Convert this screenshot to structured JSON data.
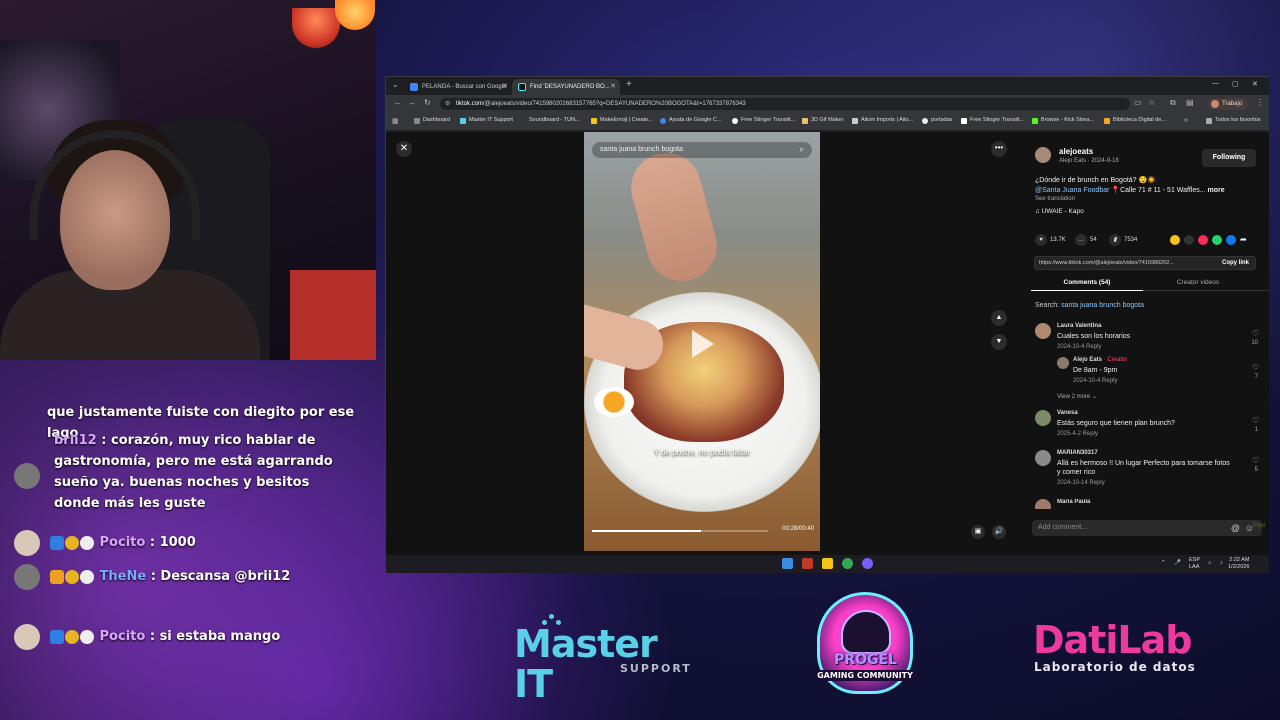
{
  "chat": {
    "messages": [
      {
        "user": "",
        "text": "que justamente fuiste con diegito por ese lago"
      },
      {
        "user": "brii12",
        "text": ": corazón, muy rico hablar de gastronomía, pero me está agarrando sueño ya. buenas noches y besitos donde más les guste"
      },
      {
        "user": "Pocito",
        "text": ": 1000"
      },
      {
        "user": "TheNe",
        "text": ": Descansa @brii12"
      },
      {
        "user": "Pocito",
        "text": ": si estaba mango"
      }
    ]
  },
  "browser": {
    "tabs": [
      {
        "label": "PELANGA - Buscar con Google",
        "active": false
      },
      {
        "label": "Find 'DESAYUNADERO BO...",
        "active": true
      }
    ],
    "url_host": "tiktok.com",
    "url_path": "/@alejoeats/video/7415980202683157765?q=DESAYUNADERO%20BOGOTA&t=1767337876343",
    "profile_label": "Trabajo",
    "bookmarks": [
      "Dashboard",
      "Master IT Support",
      "Soundboard - TUN...",
      "MakeEmoji | Create...",
      "Ayuda de Google C...",
      "Free Stinger Transiti...",
      "3D Gif Maker",
      "Aitum Imports | Aitu...",
      "portadas",
      "Free Stinger Transiti...",
      "Browse - Kick Strea...",
      "Biblioteca Digital de...",
      "Todos los favoritos"
    ]
  },
  "video": {
    "search_text": "santa juana brunch bogota",
    "caption": "Y de postre, no podía faltar",
    "time": "00:28/00:40",
    "progress_fraction": 0.62
  },
  "post": {
    "author": "alejoeats",
    "author_sub": "Alejo Eats · 2024-9-18",
    "follow_label": "Following",
    "desc_line1": "¿Dónde ir de brunch en Bogotá? 🤤☀️",
    "desc_tag": "@Santa Juana Foodbar",
    "desc_rest": " 📍Calle 71 # 11 - 51 Waffles...",
    "more_label": "more",
    "see_translation": "See translation",
    "music": "♫ UWAIE - Kapo",
    "likes": "13.7K",
    "comments_count": "54",
    "saves": "7534",
    "link": "https://www.tiktok.com/@alejoeats/video/7415980202...",
    "copy_link": "Copy link",
    "tab_comments": "Comments (54)",
    "tab_creator": "Creator videos",
    "search_prefix": "Search:",
    "search_query": "santa juana brunch bogota",
    "comments": [
      {
        "name": "Laura Valentina",
        "text": "Cuales son los horarios",
        "meta": "2024-10-4     Reply",
        "likes": "10"
      },
      {
        "name": "Alejo Eats",
        "creator": "· Creator",
        "text": "De 8am - 9pm",
        "meta": "2024-10-4     Reply",
        "likes": "7"
      },
      {
        "name": "Vanesa",
        "text": "Estás seguro que tienen plan brunch?",
        "meta": "2025-4-2     Reply",
        "likes": "1"
      },
      {
        "name": "MARIAN30317",
        "text": "Allá es hermoso !! Un lugar Perfecto para tomarse fotos y comer rico",
        "meta": "2024-10-14     Reply",
        "likes": "5"
      },
      {
        "name": "Maria Paula",
        "text": "",
        "meta": "",
        "likes": ""
      }
    ],
    "view_more": "View 2 more ⌄",
    "add_comment_placeholder": "Add comment...",
    "post_label": "Post"
  },
  "taskbar": {
    "lang": "ESP",
    "lang2": "LAA",
    "time": "2:22 AM",
    "date": "1/2/2026"
  },
  "logos": {
    "master_title": "Master IT",
    "master_sub": "SUPPORT",
    "gaming_title": "PROGEL",
    "gaming_sub": "GAMING COMMUNITY",
    "dati_title": "DatiLab",
    "dati_sub": "Laboratorio de datos"
  }
}
